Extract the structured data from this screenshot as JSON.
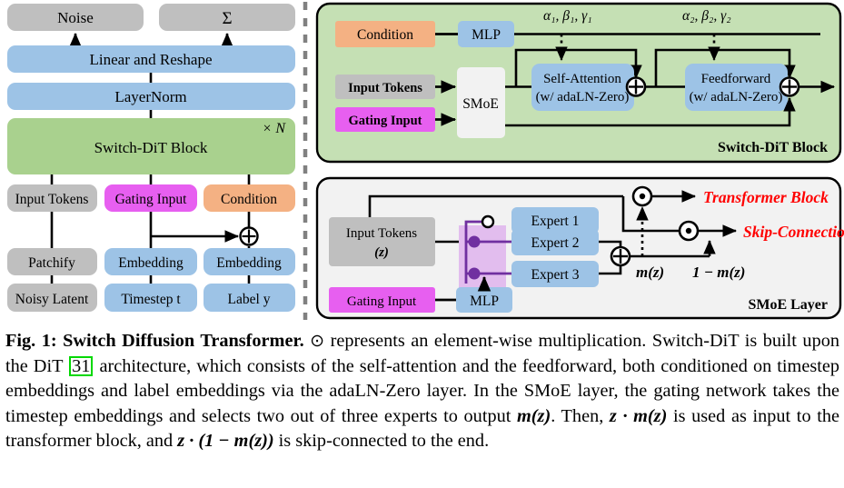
{
  "figure": {
    "colors": {
      "gray": "#bfbfbf",
      "blue": "#9dc3e6",
      "green": "#a9d18e",
      "panel_green": "#c5e0b4",
      "panel_gray": "#f2f2f2",
      "magenta": "#e75ff0",
      "orange": "#f4b183",
      "light_purple": "#e2bdee",
      "purple_line": "#7030a0",
      "red": "#ff0000",
      "cite_green": "#00d800",
      "black": "#000000",
      "smoe_fill": "#f2f2f2"
    },
    "left_panel": {
      "name": "overall-architecture",
      "boxes": {
        "noise": "Noise",
        "sigma": "Σ",
        "linear_reshape": "Linear and Reshape",
        "layernorm": "LayerNorm",
        "switch_dit_block": "Switch-DiT Block",
        "repeat_label": "× N",
        "input_tokens": "Input Tokens",
        "gating_input": "Gating Input",
        "condition": "Condition",
        "patchify": "Patchify",
        "embedding_t": "Embedding",
        "embedding_y": "Embedding",
        "noisy_latent": "Noisy Latent",
        "timestep": "Timestep t",
        "label_y": "Label y",
        "plus_node": "⊕"
      }
    },
    "block_panel": {
      "name": "switch-dit-block",
      "title": "Switch-DiT Block",
      "boxes": {
        "condition": "Condition",
        "mlp": "MLP",
        "input_tokens": "Input Tokens",
        "gating_input": "Gating Input",
        "smoe": "SMoE",
        "self_attention_l1": "Self-Attention",
        "self_attention_l2": "(w/ adaLN-Zero)",
        "feedforward_l1": "Feedforward",
        "feedforward_l2": "(w/ adaLN-Zero)"
      },
      "params": {
        "set1": "α₁, β₁, γ₁",
        "set2": "α₂, β₂, γ₂"
      },
      "adders": {
        "add1": "⊕",
        "add2": "⊕"
      }
    },
    "smoe_panel": {
      "name": "smoe-layer",
      "title": "SMoE Layer",
      "boxes": {
        "input_tokens_l1": "Input Tokens",
        "input_tokens_l2": "(z)",
        "gating_input": "Gating Input",
        "mlp": "MLP",
        "expert1": "Expert 1",
        "expert2": "Expert 2",
        "expert3": "Expert 3"
      },
      "labels": {
        "m_of_z": "m(z)",
        "one_minus_m_of_z": "1 − m(z)",
        "transformer_block": "Transformer Block",
        "skip_connection": "Skip-Connection"
      },
      "adder": "⊕",
      "mult1": "⊙",
      "mult2": "⊙"
    }
  },
  "caption": {
    "fig_label": "Fig. 1: Switch Diffusion Transformer.",
    "odot": "⊙",
    "part1": " represents an element-wise multiplication. Switch-DiT is built upon the DiT ",
    "citation": "31",
    "part2": " architecture, which consists of the self-attention and the feedforward, both conditioned on timestep embeddings and label embeddings via the adaLN-Zero layer. In the SMoE layer, the gating network takes the timestep embeddings and selects two out of three experts to output ",
    "m_of_z": "m(z)",
    "part3": ". Then, ",
    "z_dot_m": "z · m(z)",
    "part4": " is used as input to the transformer block, and ",
    "z_dot_one_minus_m": "z · (1 − m(z))",
    "part5": " is skip-connected to the end."
  }
}
